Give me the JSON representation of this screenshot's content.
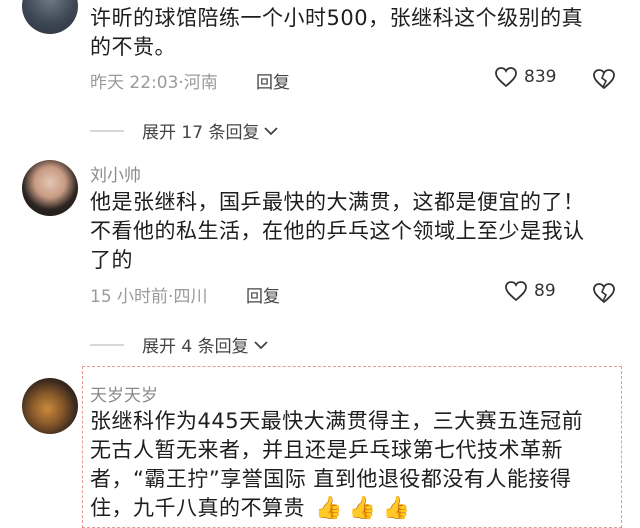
{
  "comments": [
    {
      "text_lines": [
        "许昕的球馆陪练一个小时500，张继科这个级别的真",
        "的不贵。"
      ],
      "time_location": "昨天 22:03·河南",
      "reply_label": "回复",
      "like_count": "839"
    },
    {
      "username": "刘小帅",
      "text_lines": [
        "他是张继科，国乒最快的大满贯，这都是便宜的了！",
        "不看他的私生活，在他的乒乓这个领域上至少是我认",
        "了的"
      ],
      "time_location": "15 小时前·四川",
      "reply_label": "回复",
      "like_count": "89"
    },
    {
      "username": "天岁天岁",
      "text_lines": [
        "张继科作为445天最快大满贯得主，三大赛五连冠前",
        "无古人暂无来者，并且还是乒乓球第七代技术革新",
        "者，“霸王拧”享誉国际 直到他退役都没有人能接得",
        "住，九千八真的不算贵"
      ]
    }
  ],
  "expand_replies": [
    {
      "label": "展开 17 条回复"
    },
    {
      "label": "展开 4 条回复"
    }
  ],
  "colors": {
    "background": "#ffffff",
    "text": "#1e1e1e",
    "meta": "#9a9a9a",
    "highlight_border": "#e89a9a"
  },
  "icons": [
    "heart-outline-icon",
    "broken-heart-icon",
    "chevron-down-icon",
    "thumbs-up-emoji-icon"
  ]
}
